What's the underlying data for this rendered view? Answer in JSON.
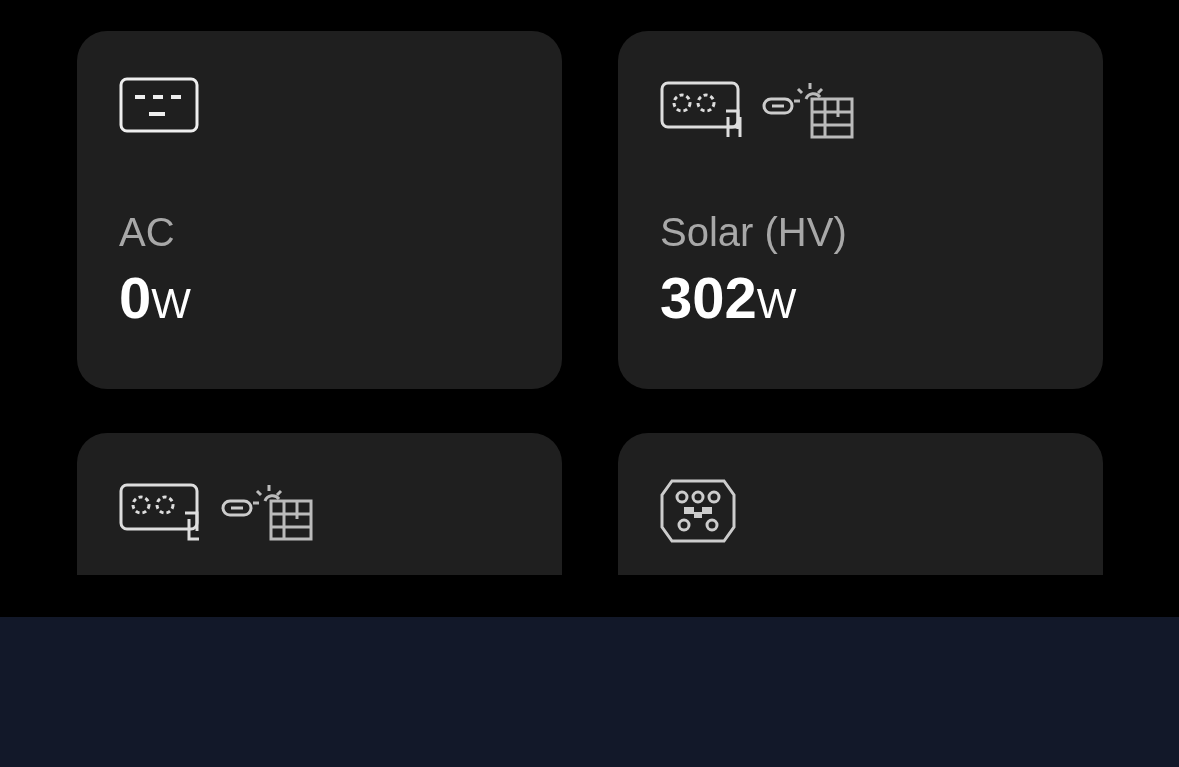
{
  "cards": [
    {
      "kind": "ac",
      "label": "AC",
      "value": "0",
      "unit": "W"
    },
    {
      "kind": "solar-hv",
      "label": "Solar (HV)",
      "value": "302",
      "unit": "W"
    },
    {
      "kind": "solar-lv"
    },
    {
      "kind": "ev"
    }
  ]
}
